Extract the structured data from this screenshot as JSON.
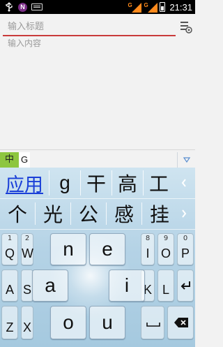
{
  "status_bar": {
    "time": "21:31",
    "icons": [
      "usb-icon",
      "notification-n-icon",
      "keyboard-icon",
      "signal-g-icon",
      "signal-g-icon",
      "battery-icon"
    ],
    "network_labels": [
      "G",
      "G"
    ]
  },
  "editor": {
    "title_placeholder": "输入标题",
    "content_placeholder": "输入内容"
  },
  "ime": {
    "mode_label": "中",
    "composing_text": "G"
  },
  "candidates": {
    "row1": [
      "应用",
      "g",
      "干",
      "高",
      "工"
    ],
    "row2": [
      "个",
      "光",
      "公",
      "感",
      "挂"
    ]
  },
  "keyboard": {
    "left_column": [
      {
        "hint": "1",
        "label": "Q"
      },
      {
        "hint": "",
        "label": "A"
      },
      {
        "hint": "",
        "label": "Z"
      }
    ],
    "second_column": [
      {
        "hint": "2",
        "label": "W"
      },
      {
        "hint": "",
        "label": "S"
      },
      {
        "hint": "",
        "label": "X"
      }
    ],
    "second_right_column": [
      {
        "hint": "8",
        "label": "I"
      },
      {
        "hint": "",
        "label": "K"
      }
    ],
    "right_column": [
      {
        "hint": "9",
        "label": "O"
      },
      {
        "hint": "",
        "label": "L"
      }
    ],
    "far_right_column": [
      {
        "hint": "0",
        "label": "P"
      }
    ],
    "center_keys": [
      "n",
      "e",
      "a",
      "i",
      "o",
      "u"
    ]
  },
  "colors": {
    "title_underline": "#c93b3b",
    "mode_badge": "#8dc63f",
    "first_candidate": "#1a3fd8",
    "keyboard_bg_top": "#cfe4f0",
    "keyboard_bg_bottom": "#a5c9df"
  }
}
